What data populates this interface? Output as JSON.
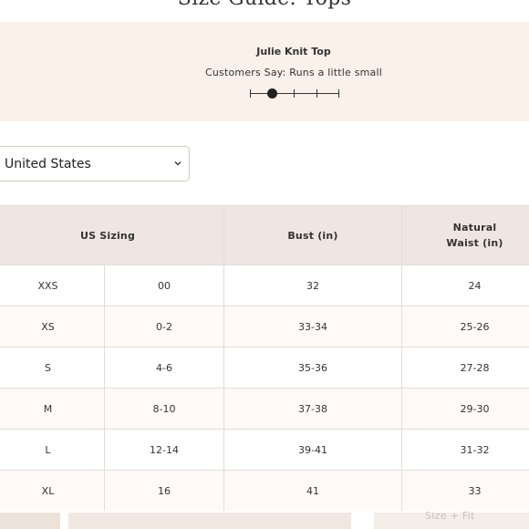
{
  "page": {
    "title": "Size Guide: Tops"
  },
  "fit": {
    "product_name": "Julie Knit Top",
    "customers_say": "Customers Say: Runs a little small",
    "scale_value": 2,
    "scale_steps": 5
  },
  "region_select": {
    "value": "United States"
  },
  "size_table": {
    "headers": [
      "US Sizing",
      "Bust (in)",
      "Natural Waist (in)"
    ],
    "rows": [
      [
        "XXS",
        "00",
        "32",
        "24"
      ],
      [
        "XS",
        "0-2",
        "33-34",
        "25-26"
      ],
      [
        "S",
        "4-6",
        "35-36",
        "27-28"
      ],
      [
        "M",
        "8-10",
        "37-38",
        "29-30"
      ],
      [
        "L",
        "12-14",
        "39-41",
        "31-32"
      ],
      [
        "XL",
        "16",
        "41",
        "33"
      ]
    ]
  },
  "footer": {
    "size_fit_label": "Size + Fit"
  },
  "icons": {
    "chevron": "chevron-down-icon"
  }
}
